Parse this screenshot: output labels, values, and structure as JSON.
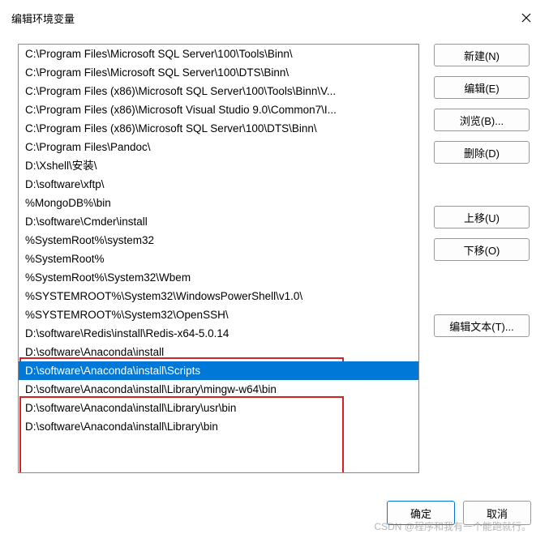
{
  "title": "编辑环境变量",
  "paths": [
    "C:\\Program Files\\Microsoft SQL Server\\100\\Tools\\Binn\\",
    "C:\\Program Files\\Microsoft SQL Server\\100\\DTS\\Binn\\",
    "C:\\Program Files (x86)\\Microsoft SQL Server\\100\\Tools\\Binn\\V...",
    "C:\\Program Files (x86)\\Microsoft Visual Studio 9.0\\Common7\\I...",
    "C:\\Program Files (x86)\\Microsoft SQL Server\\100\\DTS\\Binn\\",
    "C:\\Program Files\\Pandoc\\",
    "D:\\Xshell\\安装\\",
    "D:\\software\\xftp\\",
    "%MongoDB%\\bin",
    "D:\\software\\Cmder\\install",
    "%SystemRoot%\\system32",
    "%SystemRoot%",
    "%SystemRoot%\\System32\\Wbem",
    "%SYSTEMROOT%\\System32\\WindowsPowerShell\\v1.0\\",
    "%SYSTEMROOT%\\System32\\OpenSSH\\",
    "D:\\software\\Redis\\install\\Redis-x64-5.0.14",
    "D:\\software\\Anaconda\\install",
    "D:\\software\\Anaconda\\install\\Scripts",
    "D:\\software\\Anaconda\\install\\Library\\mingw-w64\\bin",
    "D:\\software\\Anaconda\\install\\Library\\usr\\bin",
    "D:\\software\\Anaconda\\install\\Library\\bin"
  ],
  "selected_index": 17,
  "buttons": {
    "new": "新建(N)",
    "edit": "编辑(E)",
    "browse": "浏览(B)...",
    "delete": "删除(D)",
    "up": "上移(U)",
    "down": "下移(O)",
    "edit_text": "编辑文本(T)...",
    "ok": "确定",
    "cancel": "取消"
  },
  "watermark": "CSDN @程序和我有一个能跑就行。"
}
